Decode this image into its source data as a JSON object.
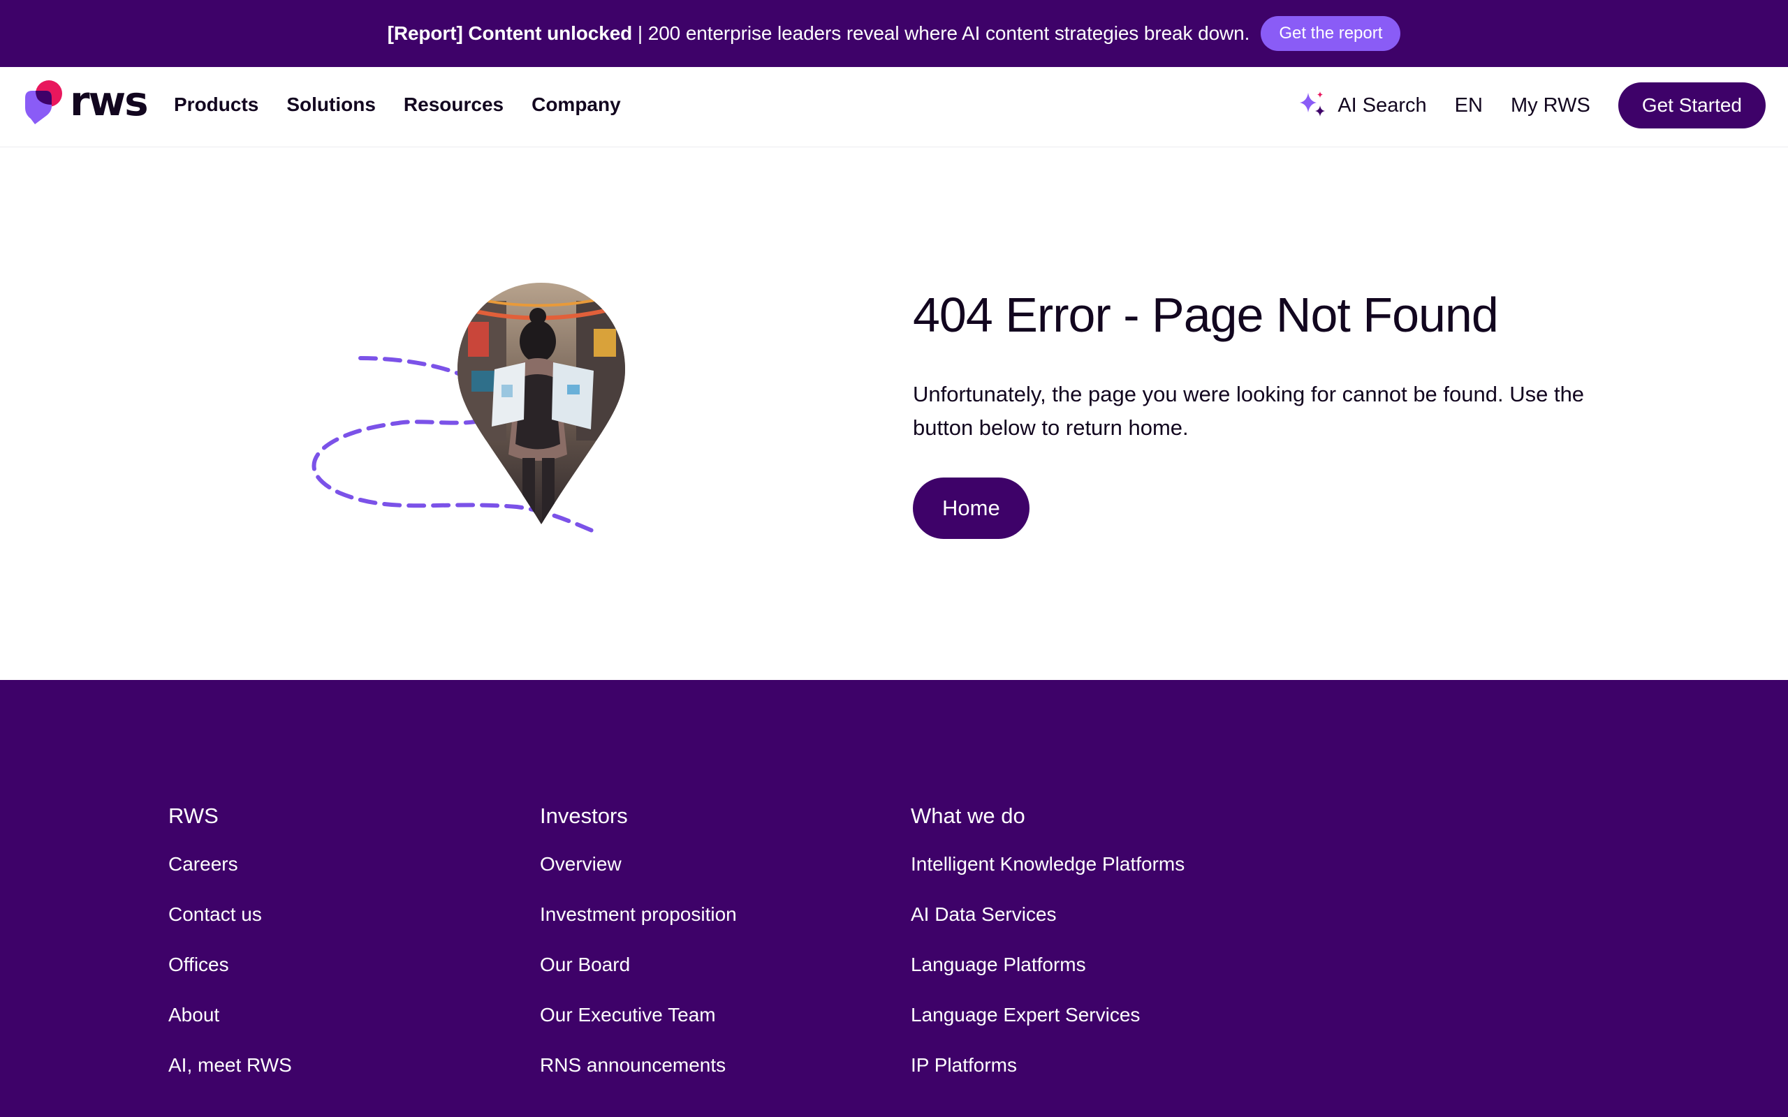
{
  "banner": {
    "bold_text": "[Report] Content unlocked",
    "text": " | 200 enterprise leaders reveal where AI content strategies break down.",
    "button_label": "Get the report"
  },
  "header": {
    "logo_text": "rws",
    "nav": [
      "Products",
      "Solutions",
      "Resources",
      "Company"
    ],
    "ai_search_label": "AI Search",
    "language": "EN",
    "my_rws_label": "My RWS",
    "cta_label": "Get Started"
  },
  "error": {
    "title": "404 Error - Page Not Found",
    "description": "Unfortunately, the page you were looking for cannot be found. Use the button below to return home.",
    "home_button": "Home"
  },
  "footer": {
    "columns": [
      {
        "heading": "RWS",
        "links": [
          "Careers",
          "Contact us",
          "Offices",
          "About",
          "AI, meet RWS"
        ]
      },
      {
        "heading": "Investors",
        "links": [
          "Overview",
          "Investment proposition",
          "Our Board",
          "Our Executive Team",
          "RNS announcements"
        ]
      },
      {
        "heading": "What we do",
        "links": [
          "Intelligent Knowledge Platforms",
          "AI Data Services",
          "Language Platforms",
          "Language Expert Services",
          "IP Platforms"
        ]
      }
    ]
  },
  "colors": {
    "brand_purple": "#3e0269",
    "accent_violet": "#8a5cf6",
    "logo_pink": "#e8175d",
    "text_dark": "#12061f"
  }
}
